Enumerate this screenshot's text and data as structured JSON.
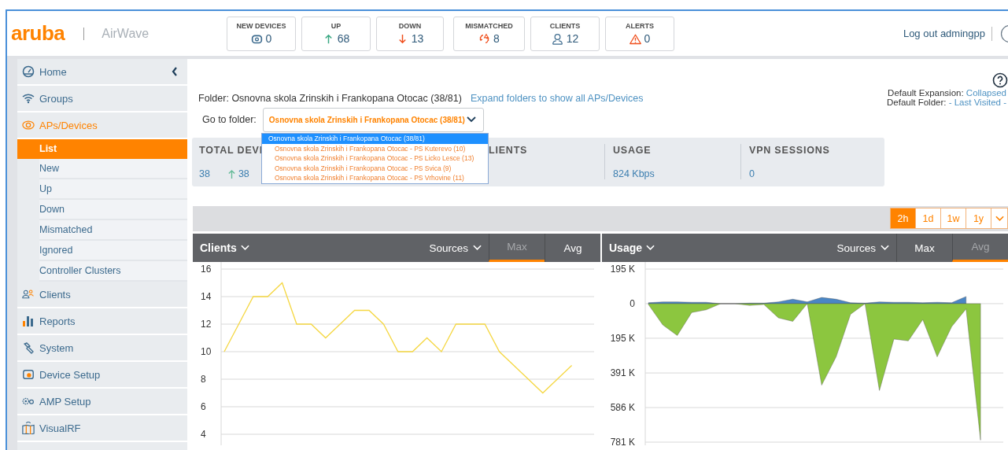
{
  "header": {
    "logo": "aruba",
    "product": "AirWave",
    "logout": "Log out admingpp"
  },
  "counters": [
    {
      "label": "NEW DEVICES",
      "value": "0",
      "kind": "new"
    },
    {
      "label": "UP",
      "value": "68",
      "kind": "up"
    },
    {
      "label": "DOWN",
      "value": "13",
      "kind": "down"
    },
    {
      "label": "MISMATCHED",
      "value": "8",
      "kind": "mismatched"
    },
    {
      "label": "CLIENTS",
      "value": "12",
      "kind": "clients"
    },
    {
      "label": "ALERTS",
      "value": "0",
      "kind": "alerts"
    }
  ],
  "sidebar": {
    "items": [
      {
        "label": "Home",
        "kind": "home",
        "selected": false
      },
      {
        "label": "Groups",
        "kind": "groups",
        "selected": false
      },
      {
        "label": "APs/Devices",
        "kind": "devices",
        "selected": true,
        "children": [
          {
            "label": "List",
            "selected": true
          },
          {
            "label": "New",
            "selected": false
          },
          {
            "label": "Up",
            "selected": false
          },
          {
            "label": "Down",
            "selected": false
          },
          {
            "label": "Mismatched",
            "selected": false
          },
          {
            "label": "Ignored",
            "selected": false
          },
          {
            "label": "Controller Clusters",
            "selected": false
          }
        ]
      },
      {
        "label": "Clients",
        "kind": "clients",
        "selected": false
      },
      {
        "label": "Reports",
        "kind": "reports",
        "selected": false
      },
      {
        "label": "System",
        "kind": "system",
        "selected": false
      },
      {
        "label": "Device Setup",
        "kind": "setup",
        "selected": false
      },
      {
        "label": "AMP Setup",
        "kind": "amp",
        "selected": false
      },
      {
        "label": "VisualRF",
        "kind": "visualrf",
        "selected": false
      }
    ]
  },
  "folder": {
    "text": "Folder: Osnovna skola Zrinskih i Frankopana Otocac (38/81)",
    "expand_link": "Expand folders to show all APs/Devices"
  },
  "defaults": {
    "expansion_label": "Default Expansion:",
    "expansion_value": "Collapsed",
    "folder_label": "Default Folder:",
    "folder_value": "- Last Visited -"
  },
  "folder_select": {
    "label": "Go to folder:",
    "value": "Osnovna skola Zrinskih i Frankopana Otocac (38/81)",
    "options": [
      {
        "label": "Osnovna skola Zrinskih i Frankopana Otocac (38/81)",
        "selected": true
      },
      {
        "label": "Osnovna skola Zrinskih i Frankopana Otocac - PS Kuterevo (10)",
        "selected": false
      },
      {
        "label": "Osnovna skola Zrinskih i Frankopana Otocac - PS Licko Lesce (13)",
        "selected": false
      },
      {
        "label": "Osnovna skola Zrinskih i Frankopana Otocac - PS Svica (9)",
        "selected": false
      },
      {
        "label": "Osnovna skola Zrinskih i Frankopana Otocac - PS Vrhovine (11)",
        "selected": false
      }
    ]
  },
  "summary": [
    {
      "heading": "TOTAL DEVI",
      "values": [
        {
          "text": "38",
          "kind": "plain"
        },
        {
          "text": "38",
          "kind": "up"
        }
      ]
    },
    {
      "heading": "LIENTS"
    },
    {
      "heading": "USAGE",
      "values": [
        {
          "text": "824 Kbps",
          "kind": "plain"
        }
      ]
    },
    {
      "heading": "VPN SESSIONS",
      "values": [
        {
          "text": "0",
          "kind": "plain"
        }
      ]
    }
  ],
  "time_range": [
    {
      "label": "2h",
      "selected": true
    },
    {
      "label": "1d",
      "selected": false
    },
    {
      "label": "1w",
      "selected": false
    },
    {
      "label": "1y",
      "selected": false
    }
  ],
  "charts": [
    {
      "title": "Clients",
      "sources": "Sources",
      "toggles": [
        {
          "label": "Max",
          "selected": true
        },
        {
          "label": "Avg",
          "selected": false
        }
      ],
      "chart_data": {
        "type": "line",
        "grid": true,
        "ylim": [
          4,
          16
        ],
        "yticks": [
          16,
          14,
          12,
          10,
          8,
          6,
          4
        ],
        "series": [
          {
            "color": "#f5d742",
            "values": [
              10,
              12,
              14,
              14,
              15,
              12,
              12,
              11,
              12,
              13,
              13,
              12,
              10,
              10,
              11,
              10,
              12,
              12,
              12,
              10,
              9,
              8,
              7,
              8,
              9
            ]
          }
        ]
      }
    },
    {
      "title": "Usage",
      "sources": "Sources",
      "toggles": [
        {
          "label": "Max",
          "selected": false
        },
        {
          "label": "Avg",
          "selected": true
        }
      ],
      "chart_data": {
        "type": "area",
        "grid": true,
        "ylim": [
          -781,
          195
        ],
        "yticks": [
          {
            "value": 195,
            "label": "195 K"
          },
          {
            "value": 0,
            "label": "0"
          },
          {
            "value": -195,
            "label": "195 K"
          },
          {
            "value": -391,
            "label": "391 K"
          },
          {
            "value": -586,
            "label": "586 K"
          },
          {
            "value": -781,
            "label": "781 K"
          }
        ],
        "series": [
          {
            "color": "#4a86c5",
            "values": [
              5,
              10,
              10,
              8,
              8,
              0,
              0,
              3,
              3,
              10,
              25,
              10,
              35,
              25,
              5,
              3,
              10,
              8,
              8,
              5,
              8,
              5,
              40
            ]
          },
          {
            "color": "#8cc63f",
            "values": [
              -5,
              -120,
              -180,
              -50,
              -35,
              0,
              0,
              -10,
              -5,
              -80,
              -100,
              0,
              -460,
              -300,
              -60,
              0,
              -490,
              -200,
              -210,
              -90,
              -300,
              -130,
              -30,
              -770
            ]
          }
        ]
      }
    }
  ]
}
